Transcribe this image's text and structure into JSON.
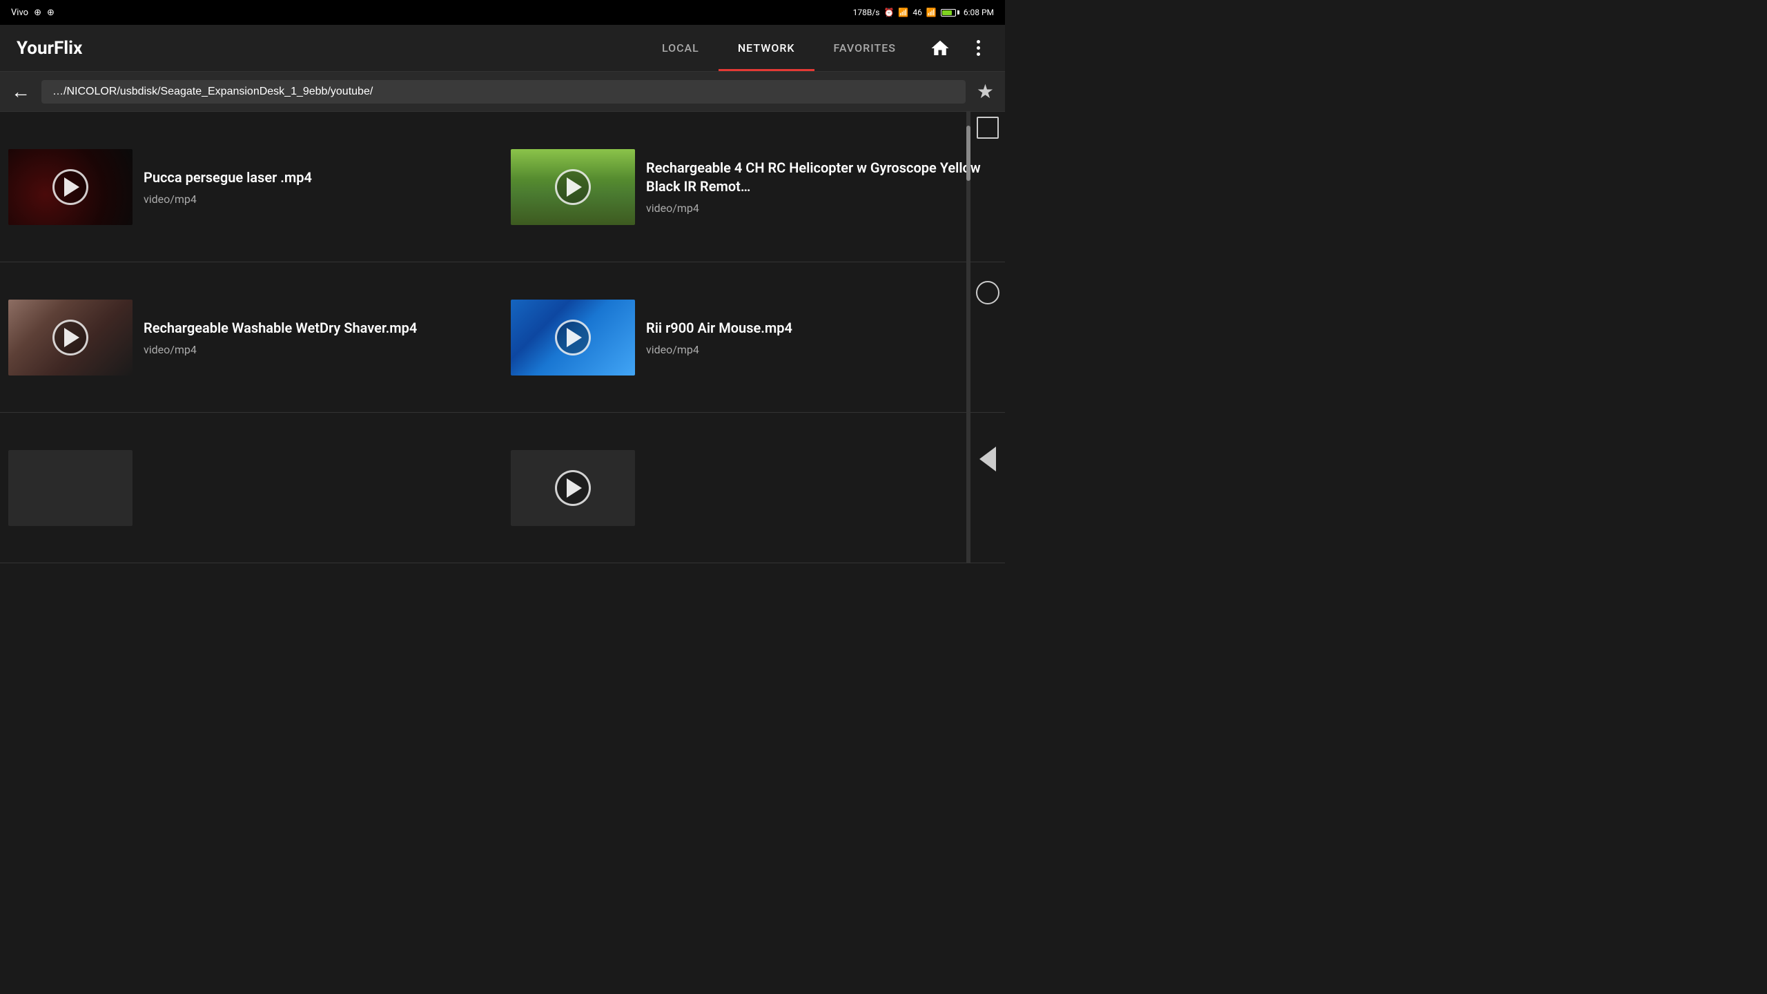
{
  "statusBar": {
    "carrier": "Vivo",
    "usb1": "↕",
    "usb2": "↕",
    "speed": "178B/s",
    "network": "46",
    "time": "6:08 PM"
  },
  "appBar": {
    "title": "YourFlix",
    "tabs": [
      {
        "id": "local",
        "label": "LOCAL",
        "active": false
      },
      {
        "id": "network",
        "label": "NETWORK",
        "active": true
      },
      {
        "id": "favorites",
        "label": "FAVORITES",
        "active": false
      }
    ]
  },
  "pathBar": {
    "path": "…/NICOLOR/usbdisk/Seagate_ExpansionDesk_1_9ebb/youtube/"
  },
  "videos": [
    {
      "id": "v1",
      "title": "Pucca persegue laser .mp4",
      "type": "video/mp4",
      "thumbClass": "thumb-laser"
    },
    {
      "id": "v2",
      "title": "Rechargeable 4 CH RC Helicopter w Gyroscope Yellow Black IR Remot…",
      "type": "video/mp4",
      "thumbClass": "thumb-helicopter"
    },
    {
      "id": "v3",
      "title": "Rechargeable Washable WetDry Shaver.mp4",
      "type": "video/mp4",
      "thumbClass": "thumb-shaver"
    },
    {
      "id": "v4",
      "title": "Rii r900 Air Mouse.mp4",
      "type": "video/mp4",
      "thumbClass": "thumb-mouse"
    },
    {
      "id": "v5",
      "title": "",
      "type": "",
      "thumbClass": "thumb-bottom"
    },
    {
      "id": "v6",
      "title": "",
      "type": "",
      "thumbClass": "thumb-bottom"
    }
  ]
}
